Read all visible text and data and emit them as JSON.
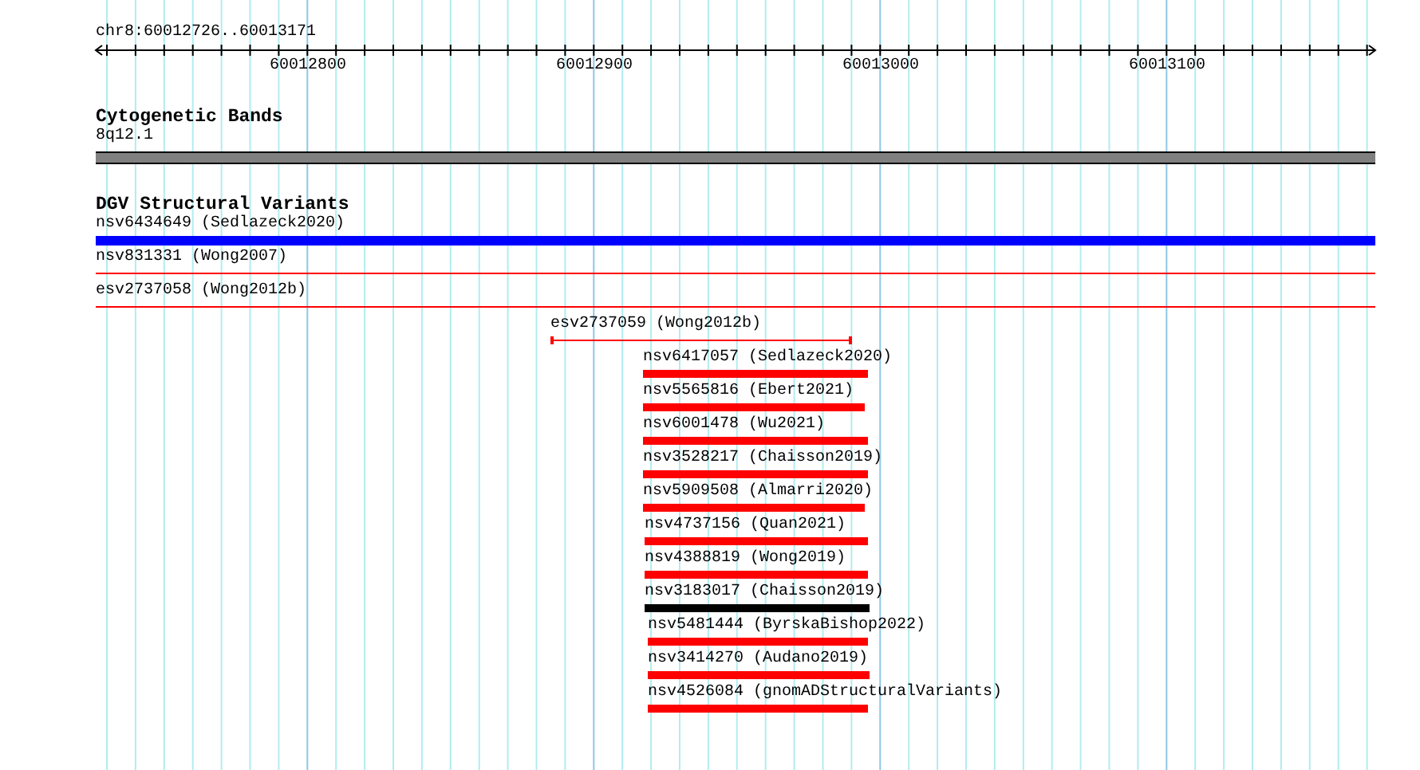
{
  "ruler": {
    "region": "chr8:60012726..60013171",
    "ticks": [
      "60012800",
      "60012900",
      "60013000",
      "60013100"
    ]
  },
  "tracks": [
    {
      "kind": "cytoband",
      "title": "Cytogenetic Bands",
      "features": [
        {
          "label": "8q12.1"
        }
      ]
    },
    {
      "kind": "variants",
      "title": "DGV Structural Variants",
      "features": [
        {
          "label": "nsv6434649 (Sedlazeck2020)",
          "kind": "bar",
          "color": "#0000ff"
        },
        {
          "label": "nsv831331 (Wong2007)",
          "kind": "line",
          "color": "#ff0000"
        },
        {
          "label": "esv2737058 (Wong2012b)",
          "kind": "line",
          "color": "#ff0000"
        },
        {
          "label": "esv2737059 (Wong2012b)",
          "kind": "span",
          "color": "#ff0000"
        },
        {
          "label": "nsv6417057 (Sedlazeck2020)",
          "kind": "bar",
          "color": "#ff0000"
        },
        {
          "label": "nsv5565816 (Ebert2021)",
          "kind": "bar",
          "color": "#ff0000"
        },
        {
          "label": "nsv6001478 (Wu2021)",
          "kind": "bar",
          "color": "#ff0000"
        },
        {
          "label": "nsv3528217 (Chaisson2019)",
          "kind": "bar",
          "color": "#ff0000"
        },
        {
          "label": "nsv5909508 (Almarri2020)",
          "kind": "bar",
          "color": "#ff0000"
        },
        {
          "label": "nsv4737156 (Quan2021)",
          "kind": "bar",
          "color": "#ff0000"
        },
        {
          "label": "nsv4388819 (Wong2019)",
          "kind": "bar",
          "color": "#ff0000"
        },
        {
          "label": "nsv3183017 (Chaisson2019)",
          "kind": "bar",
          "color": "#000000"
        },
        {
          "label": "nsv5481444 (ByrskaBishop2022)",
          "kind": "bar",
          "color": "#ff0000"
        },
        {
          "label": "nsv3414270 (Audano2019)",
          "kind": "bar",
          "color": "#ff0000"
        },
        {
          "label": "nsv4526084 (gnomADStructuralVariants)",
          "kind": "bar",
          "color": "#ff0000"
        }
      ]
    }
  ]
}
